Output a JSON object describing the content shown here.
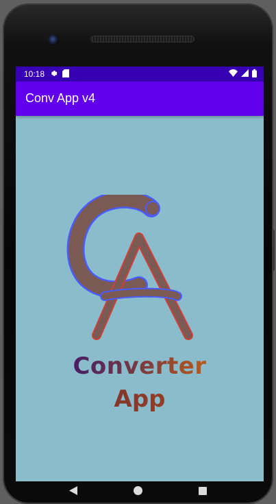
{
  "status_bar": {
    "time": "10:18",
    "left_icons": [
      "settings-icon",
      "sd-card-icon"
    ],
    "right_icons": [
      "wifi-icon",
      "signal-icon",
      "battery-icon"
    ]
  },
  "app_bar": {
    "title": "Conv App v4"
  },
  "logo": {
    "monogram": "CA",
    "line1": "Converter",
    "line2": "App"
  },
  "navigation": {
    "buttons": [
      "back-icon",
      "home-icon",
      "overview-icon"
    ]
  },
  "colors": {
    "status_bar": "#3700b3",
    "app_bar": "#6200ee",
    "background": "#8bbccc",
    "logo_fill": "#7a5a52",
    "logo_outline_blue": "#4a5cff",
    "logo_outline_red": "#d0403a"
  }
}
